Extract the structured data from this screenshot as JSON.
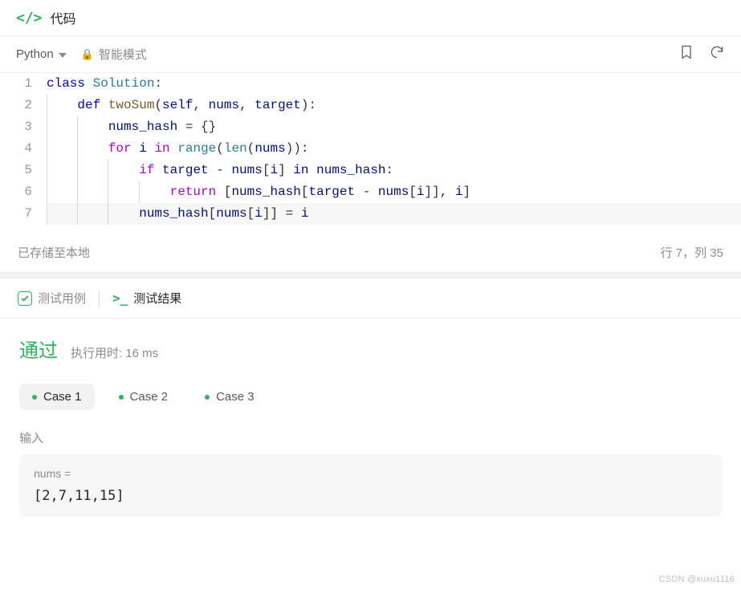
{
  "header": {
    "title": "代码"
  },
  "toolbar": {
    "language": "Python",
    "mode": "智能模式"
  },
  "code": {
    "lines": [
      1,
      2,
      3,
      4,
      5,
      6,
      7
    ],
    "t1_class": "class",
    "t1_name": "Solution",
    "t2_def": "def",
    "t2_fn": "twoSum",
    "t2_args_self": "self",
    "t2_args_nums": "nums",
    "t2_args_target": "target",
    "t3_var": "nums_hash",
    "t3_rhs": "{}",
    "t3_eq": " = ",
    "t4_for": "for",
    "t4_i": "i",
    "t4_in": "in",
    "t4_range": "range",
    "t4_len": "len",
    "t4_arg": "nums",
    "t5_if": "if",
    "t5_target": "target",
    "t5_minus": " - ",
    "t5_nums": "nums",
    "t5_i": "i",
    "t5_in": "in",
    "t5_hash": "nums_hash",
    "t6_return": "return",
    "t6_hash": "nums_hash",
    "t6_target": "target",
    "t6_nums": "nums",
    "t6_i": "i",
    "t7_hash": "nums_hash",
    "t7_nums": "nums",
    "t7_i": "i",
    "t7_eq": " = ",
    "t7_rhs": "i"
  },
  "status": {
    "saved": "已存储至本地",
    "cursor": "行 7，列 35"
  },
  "results": {
    "tab_cases": "测试用例",
    "tab_results": "测试结果",
    "pass": "通过",
    "runtime": "执行用时: 16 ms",
    "cases": [
      "Case 1",
      "Case 2",
      "Case 3"
    ],
    "input_label": "输入",
    "input_var": "nums =",
    "input_val": "[2,7,11,15]"
  },
  "watermark": "CSDN @xuxu1116"
}
